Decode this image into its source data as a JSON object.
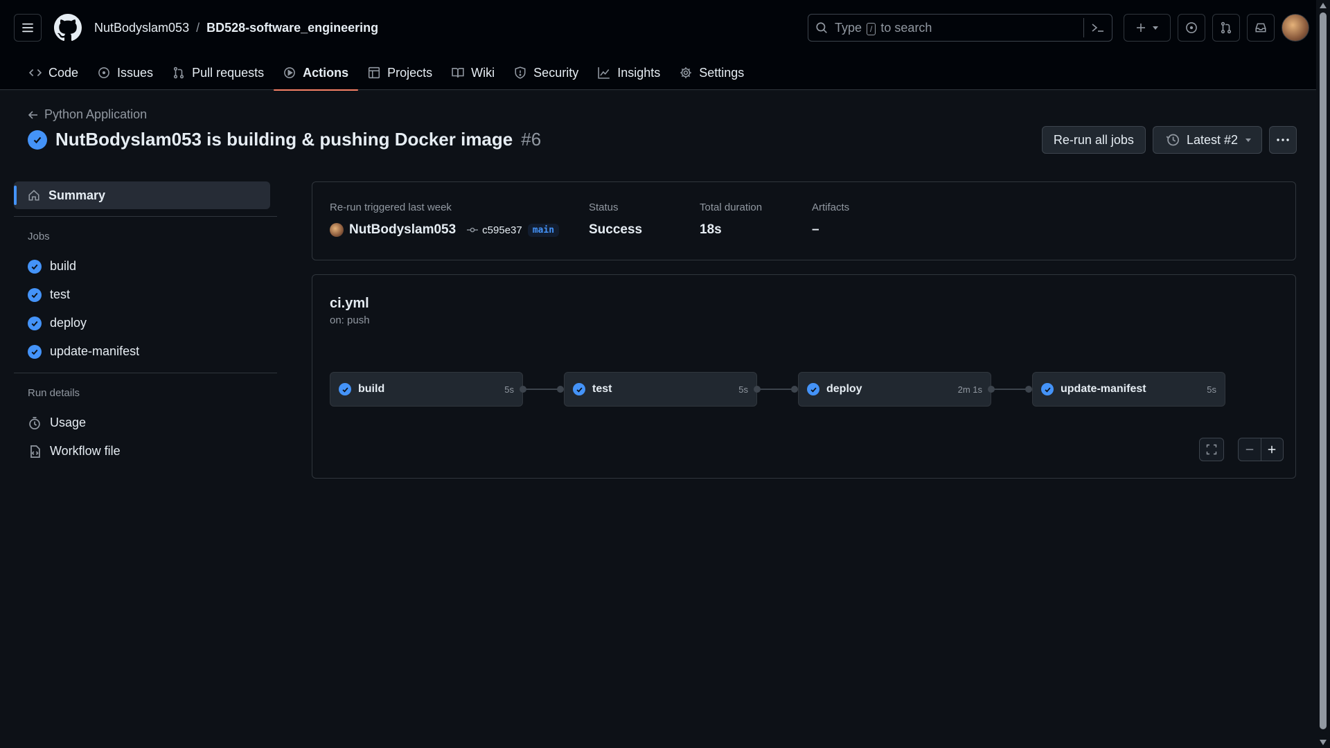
{
  "header": {
    "owner": "NutBodyslam053",
    "separator": "/",
    "repo": "BD528-software_engineering",
    "search_before": "Type",
    "search_key": "/",
    "search_after": "to search"
  },
  "tabs": [
    {
      "label": "Code",
      "icon": "code-icon"
    },
    {
      "label": "Issues",
      "icon": "issue-icon"
    },
    {
      "label": "Pull requests",
      "icon": "pull-request-icon"
    },
    {
      "label": "Actions",
      "icon": "play-icon"
    },
    {
      "label": "Projects",
      "icon": "table-icon"
    },
    {
      "label": "Wiki",
      "icon": "book-icon"
    },
    {
      "label": "Security",
      "icon": "shield-icon"
    },
    {
      "label": "Insights",
      "icon": "graph-icon"
    },
    {
      "label": "Settings",
      "icon": "gear-icon"
    }
  ],
  "run": {
    "back_label": "Python Application",
    "title": "NutBodyslam053 is building & pushing Docker image",
    "number": "#6",
    "rerun_label": "Re-run all jobs",
    "attempt_label": "Latest #2"
  },
  "sidebar": {
    "summary_label": "Summary",
    "jobs_heading": "Jobs",
    "jobs": [
      "build",
      "test",
      "deploy",
      "update-manifest"
    ],
    "run_details_heading": "Run details",
    "usage_label": "Usage",
    "workflow_file_label": "Workflow file"
  },
  "summary": {
    "trigger_label": "Re-run triggered last week",
    "actor": "NutBodyslam053",
    "commit": "c595e37",
    "branch": "main",
    "status_label": "Status",
    "status_value": "Success",
    "duration_label": "Total duration",
    "duration_value": "18s",
    "artifacts_label": "Artifacts",
    "artifacts_value": "–"
  },
  "workflow": {
    "file": "ci.yml",
    "trigger": "on: push",
    "jobs": [
      {
        "name": "build",
        "duration": "5s"
      },
      {
        "name": "test",
        "duration": "5s"
      },
      {
        "name": "deploy",
        "duration": "2m 1s"
      },
      {
        "name": "update-manifest",
        "duration": "5s"
      }
    ]
  },
  "colors": {
    "accent": "#4493f8",
    "tab_underline": "#f78166",
    "background": "#0d1117"
  }
}
